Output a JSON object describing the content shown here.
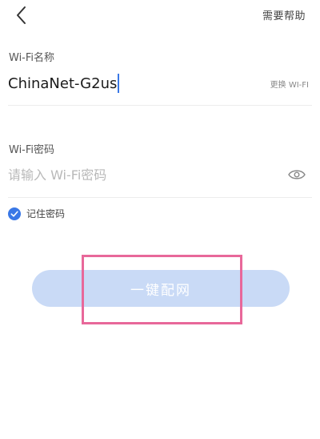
{
  "header": {
    "back_icon": "chevron-left-icon",
    "help_label": "需要帮助"
  },
  "ssid": {
    "label": "Wi-Fi名称",
    "value": "ChinaNet-G2us",
    "change_label": "更换 WI-FI"
  },
  "password": {
    "label": "Wi-Fi密码",
    "placeholder": "请输入 Wi-Fi密码",
    "value": "",
    "visibility_icon": "eye-icon"
  },
  "remember": {
    "label": "记住密码",
    "checked": true,
    "icon": "checkmark-circle-icon"
  },
  "connect": {
    "label": "一键配网",
    "enabled": false
  },
  "colors": {
    "accent": "#3a78e6",
    "button_disabled": "#c9daf6",
    "highlight": "#e8689a"
  }
}
